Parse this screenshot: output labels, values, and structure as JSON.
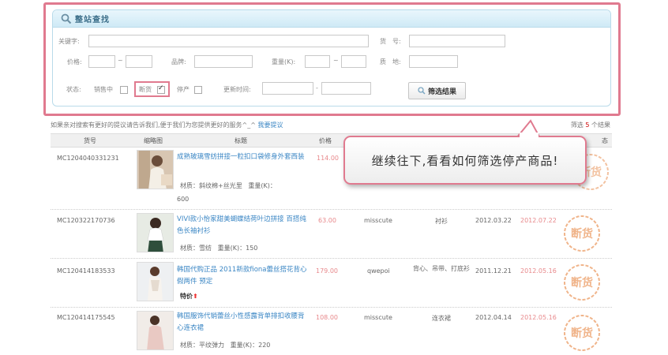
{
  "panel": {
    "title": "整站查找",
    "keyword_label": "关键字:",
    "itemno_label": "货　号:",
    "price_label": "价格:",
    "brand_label": "品牌:",
    "weight_label": "重量(K):",
    "origin_label": "质　地:",
    "tilde": "~",
    "status_label": "状态:",
    "on_sale_label": "销售中",
    "out_of_stock_label": "断货",
    "discontinued_label": "停产",
    "update_time_label": "更新时间:",
    "dash": "-",
    "filter_button": "筛选结果"
  },
  "note": {
    "text": "如果亲对搜索有更好的提议请告诉我们,便于我们为您提供更好的服务^_^",
    "link": "我要提议"
  },
  "result_count": {
    "prefix": "筛选",
    "count": "5",
    "suffix": "个结果"
  },
  "table": {
    "headers": {
      "itemno": "货号",
      "thumb": "缩略图",
      "title": "标题",
      "price": "价格",
      "extra": "态"
    },
    "rows": [
      {
        "itemno": "MC1204040331231",
        "title": "成熟玻璃雪纺拼接一粒扣口袋修身外套西装",
        "material": "材质：斜纹棉+丝光里",
        "weight": "重量(K)：",
        "weight_value": "600",
        "price": "114.00",
        "stamp": "断货"
      },
      {
        "itemno": "MC120322170736",
        "title": "VIVI款小怡家甜美蝴蝶结荷叶边拼接 百搭纯色长袖衬衫",
        "material": "材质：雪纺",
        "weight": "重量(K)：150",
        "price": "63.00",
        "seller": "misscute",
        "category": "衬衫",
        "date1": "2012.03.22",
        "date2": "2012.07.22",
        "stamp": "断货"
      },
      {
        "itemno": "MC120414183533",
        "title": "韩国代购正品 2011新款fiona蕾丝搭花背心假两件 预定",
        "tejia": "特价",
        "price": "179.00",
        "seller": "qwepoi",
        "category": "背心、吊带、打底衫",
        "date1": "2011.12.21",
        "date2": "2012.05.16",
        "stamp": "断货"
      },
      {
        "itemno": "MC120414175545",
        "title": "韩国服饰代销蕾丝小性感露背单排扣收腰背心连衣裙",
        "material": "材质：平纹弹力",
        "weight": "重量(K)：220",
        "price": "108.00",
        "seller": "misscute",
        "category": "连衣裙",
        "date1": "2012.04.14",
        "date2": "2012.05.16",
        "stamp": "断货"
      }
    ]
  },
  "callout": {
    "text": "继续往下,看看如何筛选停产商品!"
  },
  "colors": {
    "highlight": "#e07a8f",
    "link": "#3a86c4",
    "price": "#e8898c",
    "stamp": "#f0b48a",
    "panel_border": "#b9dbea"
  },
  "icons": [
    "search-icon",
    "checkbox-icon",
    "out-of-stock-stamp-icon",
    "up-arrow-icon"
  ]
}
